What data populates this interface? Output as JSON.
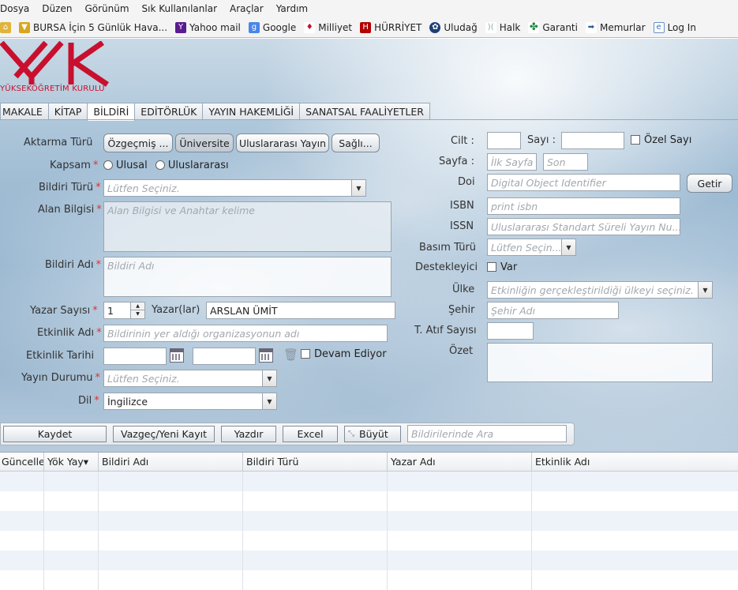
{
  "menu": [
    "Dosya",
    "Düzen",
    "Görünüm",
    "Sık Kullanılanlar",
    "Araçlar",
    "Yardım"
  ],
  "bookmarks": [
    {
      "label": "",
      "icon": "home-icon"
    },
    {
      "label": "BURSA İçin 5 Günlük Hava...",
      "icon": "weather-icon"
    },
    {
      "label": "Yahoo mail",
      "icon": "yahoo-icon"
    },
    {
      "label": "Google",
      "icon": "google-icon"
    },
    {
      "label": "Milliyet",
      "icon": "milliyet-icon"
    },
    {
      "label": "HÜRRİYET",
      "icon": "hurriyet-icon"
    },
    {
      "label": "Uludağ",
      "icon": "uludag-icon"
    },
    {
      "label": "Halk",
      "icon": "halk-icon"
    },
    {
      "label": "Garanti",
      "icon": "garanti-icon"
    },
    {
      "label": "Memurlar",
      "icon": "memurlar-icon"
    },
    {
      "label": "Log In",
      "icon": "login-icon"
    }
  ],
  "logo_text": "YÜKSEKÖĞRETİM KURULU",
  "tabs": [
    "MAKALE",
    "KİTAP",
    "BİLDİRİ",
    "EDİTÖRLÜK",
    "YAYIN HAKEMLİĞİ",
    "SANATSAL FAALİYETLER"
  ],
  "active_tab": "BİLDİRİ",
  "form": {
    "aktarma_label": "Aktarma Türü",
    "aktarma_buttons": [
      "Özgeçmiş ...",
      "Üniversite",
      "Uluslararası Yayın",
      "Sağlı..."
    ],
    "kapsam_label": "Kapsam",
    "kapsam_options": [
      "Ulusal",
      "Uluslararası"
    ],
    "bildiri_turu_label": "Bildiri Türü",
    "bildiri_turu_placeholder": "Lütfen Seçiniz.",
    "alan_label": "Alan Bilgisi",
    "alan_placeholder": "Alan Bilgisi ve Anahtar kelime",
    "bildiri_adi_label": "Bildiri Adı",
    "bildiri_adi_placeholder": "Bildiri Adı",
    "yazar_sayisi_label": "Yazar Sayısı",
    "yazar_sayisi_value": "1",
    "yazarlar_label": "Yazar(lar)",
    "yazarlar_value": "ARSLAN ÜMİT",
    "etkinlik_adi_label": "Etkinlik Adı",
    "etkinlik_adi_placeholder": "Bildirinin yer aldığı organizasyonun adı",
    "etkinlik_tarihi_label": "Etkinlik Tarihi",
    "devam_label": "Devam Ediyor",
    "yayin_durumu_label": "Yayın Durumu",
    "yayin_durumu_placeholder": "Lütfen Seçiniz.",
    "dil_label": "Dil",
    "dil_value": "İngilizce",
    "cilt_label": "Cilt :",
    "sayi_label": "Sayı :",
    "ozel_sayi_label": "Özel Sayı",
    "sayfa_label": "Sayfa :",
    "ilk_sayfa_placeholder": "İlk Sayfa",
    "son_placeholder": "Son",
    "doi_label": "Doi",
    "doi_placeholder": "Digital Object Identifier",
    "getir_label": "Getir",
    "isbn_label": "ISBN",
    "isbn_placeholder": "print isbn",
    "issn_label": "ISSN",
    "issn_placeholder": "Uluslararası Standart Süreli Yayın Nu...",
    "basim_label": "Basım Türü",
    "basim_placeholder": "Lütfen Seçin...",
    "destekleyici_label": "Destekleyici",
    "var_label": "Var",
    "ulke_label": "Ülke",
    "ulke_placeholder": "Etkinliğin gerçekleştirildiği ülkeyi seçiniz.",
    "sehir_label": "Şehir",
    "sehir_placeholder": "Şehir Adı",
    "atif_label": "T. Atıf Sayısı",
    "ozet_label": "Özet"
  },
  "actions": {
    "kaydet": "Kaydet",
    "vazgec": "Vazgeç/Yeni Kayıt",
    "yazdir": "Yazdır",
    "excel": "Excel",
    "buyut": "Büyüt",
    "search_placeholder": "Bildirilerinde Ara"
  },
  "grid": {
    "columns": [
      "Güncelle",
      "Yök Yay▾",
      "Bildiri Adı",
      "Bildiri Türü",
      "Yazar Adı",
      "Etkinlik Adı"
    ]
  }
}
